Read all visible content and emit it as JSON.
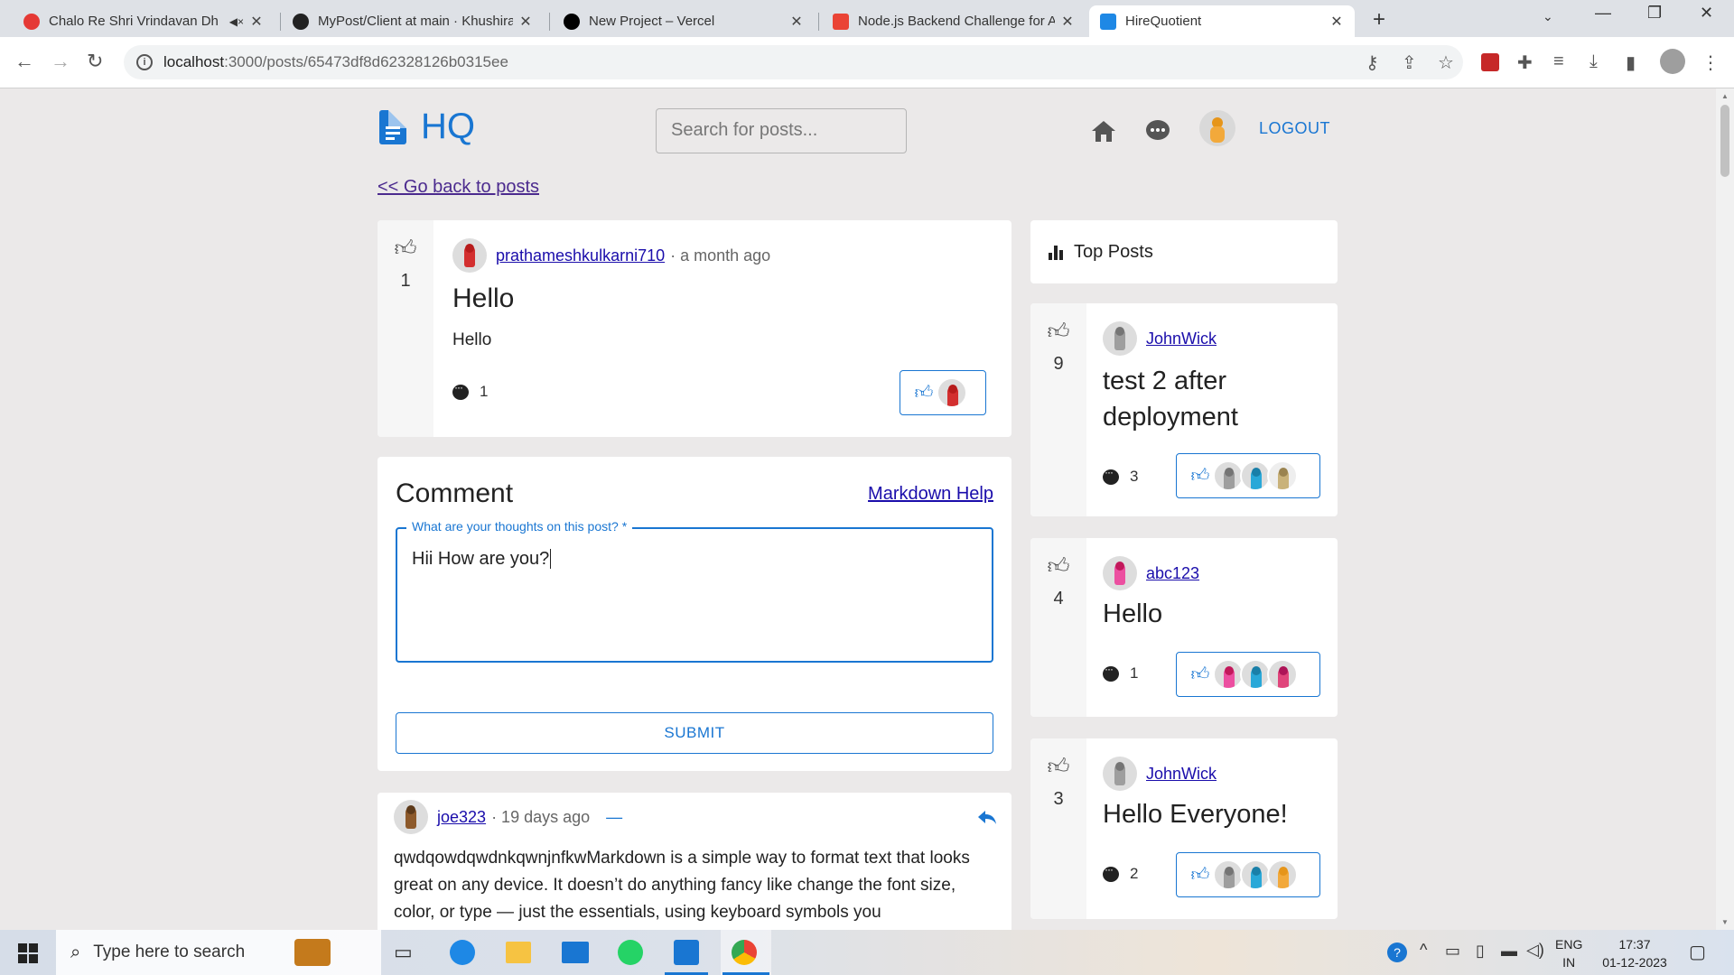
{
  "browser": {
    "tabs": [
      {
        "title": "Chalo Re Shri Vrindavan Dh",
        "favicon_color": "#e53935",
        "muted": true
      },
      {
        "title": "MyPost/Client at main · Khushira",
        "favicon_color": "#222222"
      },
      {
        "title": "New Project – Vercel",
        "favicon_color": "#000000"
      },
      {
        "title": "Node.js Backend Challenge for A",
        "favicon_color": "#ea4335"
      },
      {
        "title": "HireQuotient",
        "favicon_color": "#1e88e5",
        "active": true
      }
    ],
    "url_host": "localhost",
    "url_rest": ":3000/posts/65473df8d62328126b0315ee"
  },
  "header": {
    "logo_text": "HQ",
    "search_placeholder": "Search for posts...",
    "logout_label": "LOGOUT"
  },
  "back_link": "<< Go back to posts",
  "post": {
    "votes": "1",
    "author": "prathameshkulkarni710",
    "time": "· a month ago",
    "title": "Hello",
    "body": "Hello",
    "comment_count": "1"
  },
  "comment_form": {
    "heading": "Comment",
    "markdown_help": "Markdown Help",
    "field_label": "What are your thoughts on this post? *",
    "field_value": "Hii How are you?",
    "submit_label": "SUBMIT"
  },
  "comments": [
    {
      "author": "joe323",
      "time": "· 19 days ago",
      "collapse": "—",
      "text": "qwdqowdqwdnkqwnjnfkwMarkdown is a simple way to format text that looks great on any device. It doesn’t do anything fancy like change the font size, color, or type — just the essentials, using keyboard symbols you"
    }
  ],
  "sidebar": {
    "title": "Top Posts",
    "posts": [
      {
        "votes": "9",
        "author": "JohnWick",
        "title": "test 2 after deployment",
        "comment_count": "3"
      },
      {
        "votes": "4",
        "author": "abc123",
        "title": "Hello",
        "comment_count": "1"
      },
      {
        "votes": "3",
        "author": "JohnWick",
        "title": "Hello Everyone!",
        "comment_count": "2"
      }
    ]
  },
  "taskbar": {
    "search_placeholder": "Type here to search",
    "lang_1": "ENG",
    "lang_2": "IN",
    "time": "17:37",
    "date": "01-12-2023"
  },
  "colors": {
    "primary": "#1976d2",
    "page_bg": "#ebe9e9",
    "link": "#1a0dab"
  }
}
